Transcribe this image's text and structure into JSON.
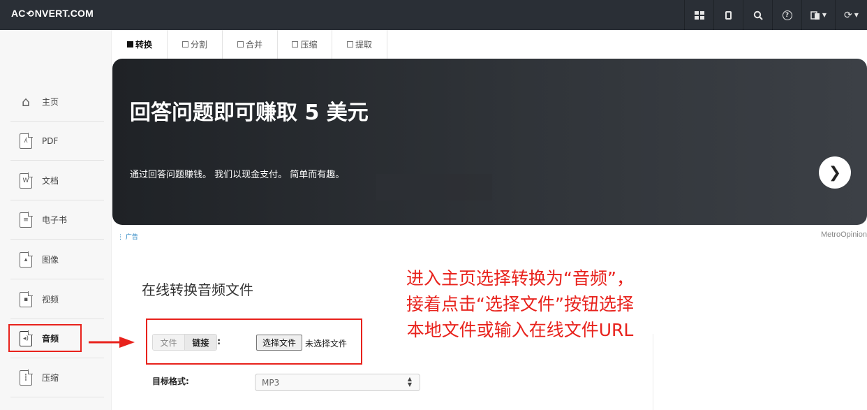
{
  "topbar": {
    "logo_prefix": "AC",
    "logo_suffix": "NVERT.COM",
    "icons": [
      "grid-icon",
      "tablet-icon",
      "search-icon",
      "help-icon",
      "language-icon",
      "refresh-icon"
    ]
  },
  "sidebar": {
    "items": [
      {
        "label": "主页",
        "icon": "home-icon"
      },
      {
        "label": "PDF",
        "icon": "pdf-icon"
      },
      {
        "label": "文档",
        "icon": "document-icon"
      },
      {
        "label": "电子书",
        "icon": "ebook-icon"
      },
      {
        "label": "图像",
        "icon": "image-icon"
      },
      {
        "label": "视频",
        "icon": "video-icon"
      },
      {
        "label": "音频",
        "icon": "audio-icon"
      },
      {
        "label": "压缩",
        "icon": "archive-icon"
      }
    ]
  },
  "tabs": [
    {
      "label": "转换",
      "active": true
    },
    {
      "label": "分割"
    },
    {
      "label": "合并"
    },
    {
      "label": "压缩"
    },
    {
      "label": "提取"
    }
  ],
  "ad": {
    "title": "回答问题即可赚取 5 美元",
    "text": "通过回答问题赚钱。 我们以现金支付。 简单而有趣。",
    "label": "广告",
    "brand": "MetroOpinion"
  },
  "main": {
    "title": "在线转换音频文件",
    "source_tabs": [
      "文件",
      "链接"
    ],
    "colon": ":",
    "file_button": "选择文件",
    "file_status": "未选择文件",
    "target_label": "目标格式:",
    "target_value": "MP3"
  },
  "annotation": {
    "lines": [
      "进入主页选择转换为“音频”，",
      "接着点击“选择文件”按钮选择",
      "本地文件或输入在线文件URL"
    ],
    "color": "#e8221c"
  }
}
